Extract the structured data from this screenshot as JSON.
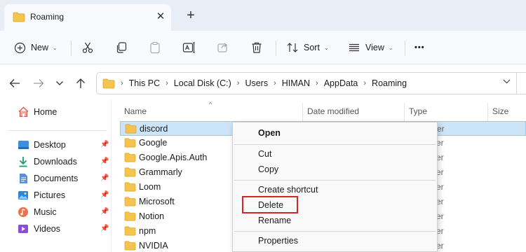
{
  "window": {
    "tab_title": "Roaming",
    "close_glyph": "✕",
    "new_tab_glyph": "+"
  },
  "toolbar": {
    "new_label": "New",
    "sort_label": "Sort",
    "view_label": "View",
    "more_glyph": "•••",
    "icons": [
      "plus-circle-icon",
      "cut-icon",
      "copy-icon",
      "paste-icon",
      "rename-icon",
      "share-icon",
      "delete-icon",
      "sort-icon",
      "view-icon",
      "more-icon"
    ]
  },
  "address": {
    "crumbs": [
      "This PC",
      "Local Disk (C:)",
      "Users",
      "HIMAN",
      "AppData",
      "Roaming"
    ],
    "sep_glyph": "›"
  },
  "sidebar": {
    "home_label": "Home",
    "quick_access": [
      {
        "label": "Desktop",
        "icon": "desktop-icon"
      },
      {
        "label": "Downloads",
        "icon": "download-icon"
      },
      {
        "label": "Documents",
        "icon": "documents-icon"
      },
      {
        "label": "Pictures",
        "icon": "pictures-icon"
      },
      {
        "label": "Music",
        "icon": "music-icon"
      },
      {
        "label": "Videos",
        "icon": "videos-icon"
      }
    ]
  },
  "columns": {
    "name": "Name",
    "date_modified": "Date modified",
    "type": "Type",
    "size": "Size"
  },
  "files": [
    {
      "name": "discord",
      "type": "er",
      "selected": true
    },
    {
      "name": "Google",
      "type": "er"
    },
    {
      "name": "Google.Apis.Auth",
      "type": "er"
    },
    {
      "name": "Grammarly",
      "type": "er"
    },
    {
      "name": "Loom",
      "type": "er"
    },
    {
      "name": "Microsoft",
      "type": "er"
    },
    {
      "name": "Notion",
      "type": "er"
    },
    {
      "name": "npm",
      "type": "er"
    },
    {
      "name": "NVIDIA",
      "type": "er"
    }
  ],
  "context_menu": {
    "open": "Open",
    "cut": "Cut",
    "copy": "Copy",
    "create_shortcut": "Create shortcut",
    "delete": "Delete",
    "rename": "Rename",
    "properties": "Properties",
    "highlighted_item": "Delete"
  },
  "colors": {
    "folder": "#f4c44e",
    "selection": "#cce4f7",
    "highlight_box": "#d4242a",
    "accent": "#0067c0"
  }
}
